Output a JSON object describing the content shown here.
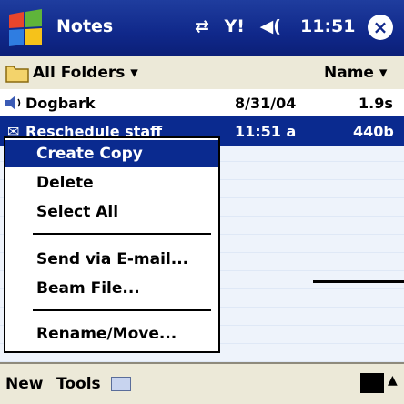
{
  "title_bar": {
    "app_title": "Notes",
    "clock": "11:51",
    "status_icons": [
      "connectivity-icon",
      "signal-icon",
      "volume-icon"
    ],
    "close_label": "×"
  },
  "folder_bar": {
    "folder_label": "All Folders ▾",
    "sort_label": "Name ▾"
  },
  "list": {
    "rows": [
      {
        "name": "Dogbark",
        "date": "8/31/04",
        "size": "1.9s",
        "icon": "sound-icon"
      },
      {
        "name": "Reschedule staff",
        "date": "11:51 a",
        "size": "440b",
        "icon": "note-icon"
      }
    ]
  },
  "context_menu": {
    "items": [
      {
        "label": "Create Copy"
      },
      {
        "label": "Delete"
      },
      {
        "label": "Select All"
      },
      {
        "label": "Send via E-mail..."
      },
      {
        "label": "Beam File..."
      },
      {
        "label": "Rename/Move..."
      }
    ]
  },
  "menu_bar": {
    "new_label": "New",
    "tools_label": "Tools"
  },
  "colors": {
    "title_bar": "#10288a",
    "selection": "#0a2a8f",
    "bar_bg": "#ece9d8"
  }
}
